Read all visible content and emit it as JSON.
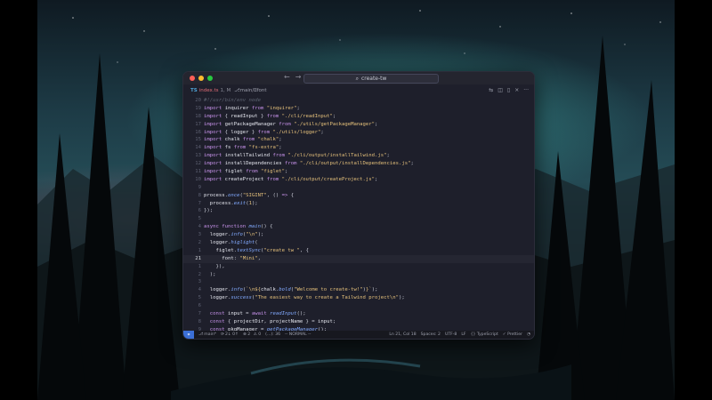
{
  "window": {
    "search": "create-tw",
    "search_icon": "search-icon",
    "back_arrow": "←",
    "forward_arrow": "→"
  },
  "tab": {
    "lang": "TS",
    "file": "index.ts",
    "modified": "1, M",
    "branch": "main/",
    "branch_tail": "font"
  },
  "editor_lines": [
    {
      "n": "20",
      "html": "<span class=\"cm\">#!/usr/bin/env node</span>"
    },
    {
      "n": "19",
      "html": "<span class=\"kw\">import</span> <span class=\"id\">inquirer</span> <span class=\"kw\">from</span> <span class=\"str\">\"inquirer\"</span>;"
    },
    {
      "n": "18",
      "html": "<span class=\"kw\">import</span> { <span class=\"id\">readInput</span> } <span class=\"kw\">from</span> <span class=\"str\">\"./cli/readInput\"</span>;"
    },
    {
      "n": "17",
      "html": "<span class=\"kw\">import</span> <span class=\"id\">getPackageManager</span> <span class=\"kw\">from</span> <span class=\"str\">\"./utils/getPackageManager\"</span>;"
    },
    {
      "n": "16",
      "html": "<span class=\"kw\">import</span> { <span class=\"id\">logger</span> } <span class=\"kw\">from</span> <span class=\"str\">\"./utils/logger\"</span>;"
    },
    {
      "n": "15",
      "html": "<span class=\"kw\">import</span> <span class=\"id\">chalk</span> <span class=\"kw\">from</span> <span class=\"str\">\"chalk\"</span>;"
    },
    {
      "n": "14",
      "html": "<span class=\"kw\">import</span> <span class=\"id\">fs</span> <span class=\"kw\">from</span> <span class=\"str\">\"fs-extra\"</span>;"
    },
    {
      "n": "13",
      "html": "<span class=\"kw\">import</span> <span class=\"id\">installTailwind</span> <span class=\"kw\">from</span> <span class=\"str\">\"./cli/output/installTailwind.js\"</span>;"
    },
    {
      "n": "12",
      "html": "<span class=\"kw\">import</span> <span class=\"id\">installDependencies</span> <span class=\"kw\">from</span> <span class=\"str\">\"./cli/output/installDependencies.js\"</span>;"
    },
    {
      "n": "11",
      "html": "<span class=\"kw\">import</span> <span class=\"id\">figlet</span> <span class=\"kw\">from</span> <span class=\"str\">\"figlet\"</span>;"
    },
    {
      "n": "10",
      "html": "<span class=\"kw\">import</span> <span class=\"id\">createProject</span> <span class=\"kw\">from</span> <span class=\"str\">\"./cli/output/createProject.js\"</span>;"
    },
    {
      "n": "9",
      "html": ""
    },
    {
      "n": "8",
      "html": "<span class=\"id\">process</span>.<span class=\"fn\">once</span>(<span class=\"str\">\"SIGINT\"</span>, () <span class=\"kw\">=&gt;</span> {"
    },
    {
      "n": "7",
      "html": "  <span class=\"id\">process</span>.<span class=\"fn\">exit</span>(<span class=\"str\">1</span>);"
    },
    {
      "n": "6",
      "html": "});"
    },
    {
      "n": "5",
      "html": ""
    },
    {
      "n": "4",
      "html": "<span class=\"kw\">async function</span> <span class=\"fn\">main</span>() {"
    },
    {
      "n": "3",
      "html": "  <span class=\"id\">logger</span>.<span class=\"fn\">info</span>(<span class=\"str\">\"\\n\"</span>);"
    },
    {
      "n": "2",
      "html": "  <span class=\"id\">logger</span>.<span class=\"fn\">higlight</span>("
    },
    {
      "n": "1",
      "html": "    <span class=\"id\">figlet</span>.<span class=\"fn\">textSync</span>(<span class=\"str\">\"create tw \"</span>, {"
    },
    {
      "n": "21",
      "html": "      <span class=\"id\">font</span>: <span class=\"str\">\"Mini\"</span>,",
      "current": true
    },
    {
      "n": "1",
      "html": "    }),"
    },
    {
      "n": "2",
      "html": "  );"
    },
    {
      "n": "3",
      "html": ""
    },
    {
      "n": "4",
      "html": "  <span class=\"id\">logger</span>.<span class=\"fn\">info</span>(<span class=\"str\">`\\n${</span><span class=\"id\">chalk</span>.<span class=\"fn\">bold</span>(<span class=\"str\">\"Welcome to create-tw!\"</span>)<span class=\"str\">}`</span>);"
    },
    {
      "n": "5",
      "html": "  <span class=\"id\">logger</span>.<span class=\"fn\">success</span>(<span class=\"str\">\"The easiest way to create a Tailwind project\\n\"</span>);"
    },
    {
      "n": "6",
      "html": ""
    },
    {
      "n": "7",
      "html": "  <span class=\"kw\">const</span> <span class=\"id\">input</span> = <span class=\"kw\">await</span> <span class=\"fn\">readInput</span>();"
    },
    {
      "n": "8",
      "html": "  <span class=\"kw\">const</span> { <span class=\"id\">projectDir</span>, <span class=\"id\">projectName</span> } = <span class=\"id\">input</span>;"
    },
    {
      "n": "9",
      "html": "  <span class=\"kw\">const</span> <span class=\"id\">pkgManager</span> = <span class=\"fn\">getPackageManager</span>();"
    }
  ],
  "status": {
    "branch": "main*",
    "sync": "2↓ 0↑",
    "errors": "⊗ 2",
    "warnings": "⚠ 0",
    "tokens": "(...): 36",
    "mode": "-- NORMAL --",
    "position": "Ln 21, Col 18",
    "spaces": "Spaces: 2",
    "encoding": "UTF-8",
    "eol": "LF",
    "language": "{} TypeScript",
    "prettier": "Prettier"
  }
}
